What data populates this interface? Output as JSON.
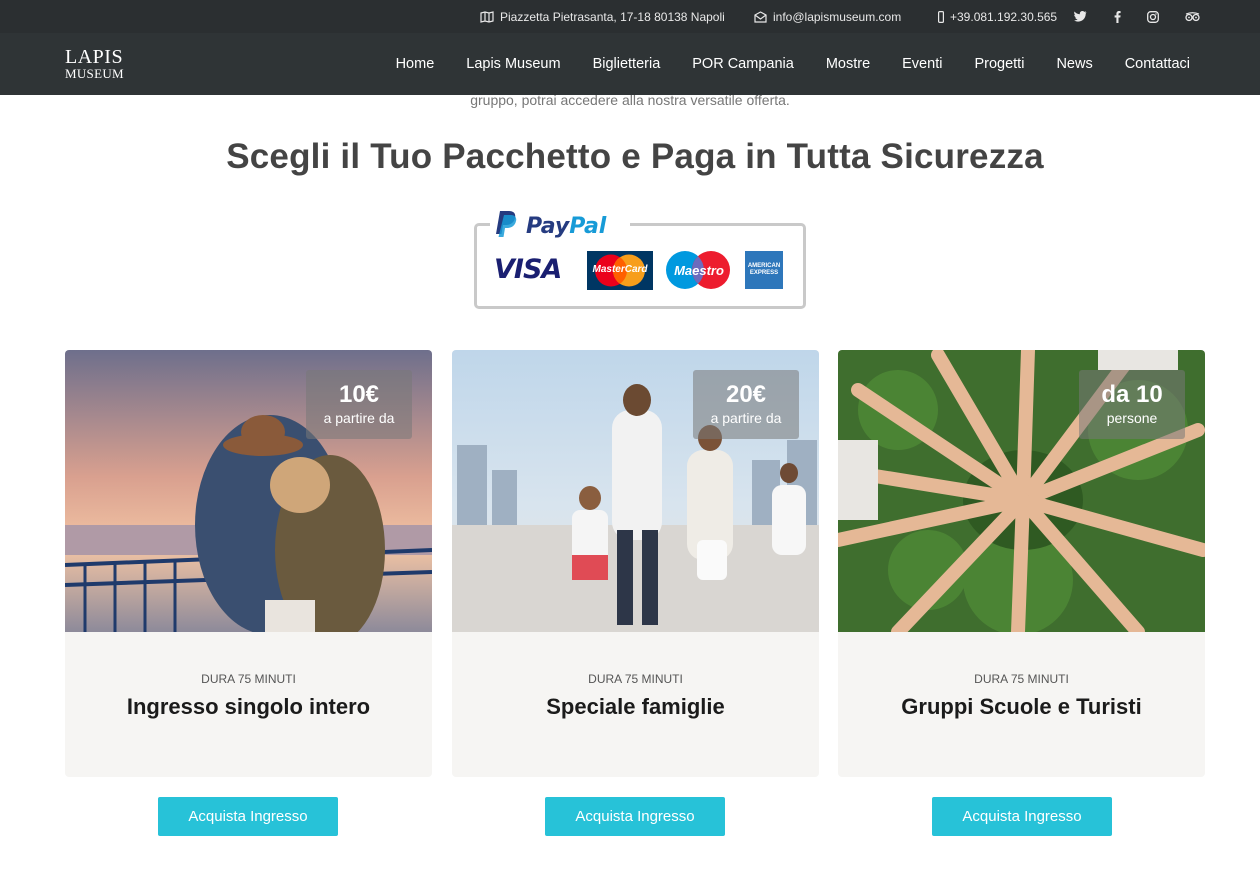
{
  "topbar": {
    "address": "Piazzetta Pietrasanta, 17-18 80138 Napoli",
    "email": "info@lapismuseum.com",
    "phone": "+39.081.192.30.565",
    "social": [
      "twitter-icon",
      "facebook-icon",
      "instagram-icon",
      "tripadvisor-icon"
    ]
  },
  "logo": {
    "line1": "LAPIS",
    "line2": "MUSEUM"
  },
  "nav": {
    "items": [
      "Home",
      "Lapis Museum",
      "Biglietteria",
      "POR Campania",
      "Mostre",
      "Eventi",
      "Progetti",
      "News",
      "Contattaci"
    ]
  },
  "intro": "gruppo, potrai accedere alla nostra versatile offerta.",
  "headline": "Scegli il Tuo Pacchetto e Paga in Tutta Sicurezza",
  "payments": {
    "paypal_a": "Pay",
    "paypal_b": "Pal",
    "visa": "VISA",
    "mastercard": "MasterCard",
    "maestro": "Maestro",
    "amex": "AMERICAN EXPRESS"
  },
  "cards": [
    {
      "price": "10€",
      "price_note": "a partire da",
      "duration": "DURA 75 MINUTI",
      "title": "Ingresso singolo intero",
      "button": "Acquista Ingresso"
    },
    {
      "price": "20€",
      "price_note": "a partire da",
      "duration": "DURA 75 MINUTI",
      "title": "Speciale famiglie",
      "button": "Acquista Ingresso"
    },
    {
      "price": "da 10",
      "price_note": "persone",
      "duration": "DURA 75 MINUTI",
      "title": "Gruppi Scuole e Turisti",
      "button": "Acquista Ingresso"
    }
  ],
  "colors": {
    "topbar": "#2b2f31",
    "navbar": "#2f3436",
    "button": "#27c2d8",
    "card": "#f6f5f3"
  }
}
